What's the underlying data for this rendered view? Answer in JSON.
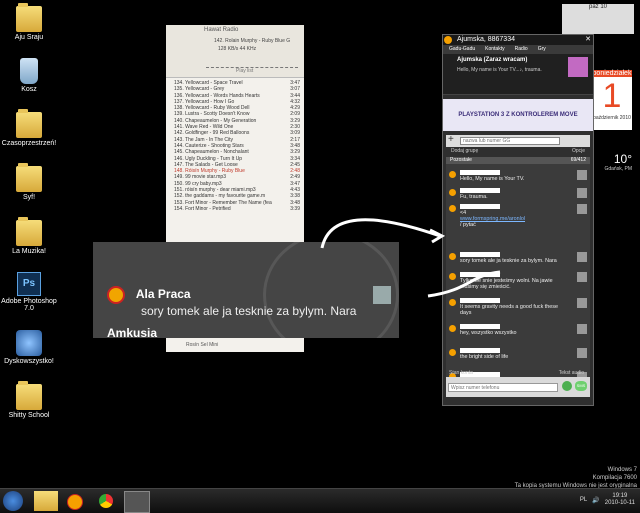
{
  "desktop": {
    "icons": [
      {
        "label": "Aju Sraju",
        "icon": "folder-icon"
      },
      {
        "label": "Kosz",
        "icon": "recycle-bin-icon"
      },
      {
        "label": "Czasoprzestrzeń!",
        "icon": "folder-icon"
      },
      {
        "label": "Syf!",
        "icon": "folder-icon"
      },
      {
        "label": "La Muzika!",
        "icon": "folder-icon"
      },
      {
        "label": "Adobe Photoshop 7.0",
        "icon": "photoshop-icon"
      },
      {
        "label": "Dyskowszystko!",
        "icon": "network-drive-icon"
      },
      {
        "label": "Shitty School",
        "icon": "folder-icon"
      }
    ]
  },
  "playlist": {
    "header_title": "Hawat Radio",
    "now_playing": "142. Rolain Murphy - Ruby Blue G",
    "bitrate": "128 KB/s 44 KHz",
    "label": "Play list",
    "tracks": [
      {
        "title": "134. Yellowcard - Space Travel",
        "time": "3:47"
      },
      {
        "title": "135. Yellowcard - Grey",
        "time": "3:07"
      },
      {
        "title": "136. Yellowcard - Words Hands Hearts",
        "time": "3:44"
      },
      {
        "title": "137. Yellowcard - How I Go",
        "time": "4:32"
      },
      {
        "title": "138. Yellowcard - Ruby Wood Dell",
        "time": "4:29"
      },
      {
        "title": "139. Lustra - Scotty Doesn't Know",
        "time": "2:09"
      },
      {
        "title": "140. Chapeaumelon - My Generation",
        "time": "3:29"
      },
      {
        "title": "141. Wave Red - Wild One",
        "time": "2:30"
      },
      {
        "title": "142. Goldfinger - 99 Red Balloons",
        "time": "3:09"
      },
      {
        "title": "143. The Jam - In The City",
        "time": "2:17"
      },
      {
        "title": "144. Cauterize - Shooting Stars",
        "time": "3:48"
      },
      {
        "title": "145. Chapeaumelon - Nonchalant",
        "time": "3:29"
      },
      {
        "title": "146. Ugly Duckling - Turn It Up",
        "time": "3:34"
      },
      {
        "title": "147. The Salads - Get Loose",
        "time": "2:45"
      },
      {
        "title": "148. Róisín Murphy - Ruby Blue",
        "time": "2:48",
        "current": true
      },
      {
        "title": "149. 99 movie star.mp3",
        "time": "2:49"
      },
      {
        "title": "150. 99 cry baby.mp3",
        "time": "3:47"
      },
      {
        "title": "151. róisín murphy - dear miami.mp3",
        "time": "4:43"
      },
      {
        "title": "152. the gaddams - my favourite game.m",
        "time": "3:38"
      },
      {
        "title": "153. Fort Minor - Remember The Name (fea",
        "time": "3:48"
      },
      {
        "title": "154. Fort Minor - Petrified",
        "time": "3:39"
      }
    ],
    "footer": "Rosín Sel Mini"
  },
  "zoom": {
    "contact1": "Ala Praca",
    "message1": "sory tomek ale ja tesknie za bylym. Nara",
    "contact2": "Amkusia"
  },
  "calendar": {
    "month": "paź 10"
  },
  "date_gadget": {
    "day_name": "poniedziałek",
    "day": "1",
    "month_year": "październik 2010"
  },
  "weather": {
    "temp": "10°",
    "city": "Gdańsk, PM"
  },
  "gg": {
    "title": "Ajumska, 8867334",
    "menu": [
      "Gadu-Gadu",
      "Kontakty",
      "Radio",
      "Gry"
    ],
    "me_name": "Ajumska (Zaraz wracam)",
    "me_desc": "Hello, My name is Your TV...♪, trauma.",
    "ad": "PLAYSTATION 3 Z KONTROLEREM MOVE",
    "search_placeholder": "nazwa lub numer GG",
    "add_group": "Dodaj grupę",
    "options": "Opcje",
    "group_name": "Pozostałe",
    "group_count": "69/412",
    "contacts": [
      {
        "line1": "Hello, My name is Your TV.",
        "line2": ""
      },
      {
        "line1": "Fu, trauma.",
        "line2": ""
      },
      {
        "line1": "<4",
        "link": "www.formspring.me/aronlol",
        "line2": "/ pytać"
      },
      {
        "line1": "sory tomek ale ja tesknie za bylym. Nara",
        "line2": ""
      },
      {
        "line1": "Tylko we snie jesteśmy wolni. Na jawie",
        "line2": "musimy się zmieścić."
      },
      {
        "line1": "It seems gravity needs a good fuck these",
        "line2": "days"
      },
      {
        "line1": "hey, wszystko wszystko",
        "line2": ""
      },
      {
        "line1": "the bright side of life",
        "line2": ""
      },
      {
        "line1": "Wykonam profesjonalne strony",
        "line2": "internetowe na zamówienie."
      }
    ],
    "status_label": "Stan konta",
    "text_audio": "Tekst audio",
    "phone_placeholder": "Wpisz numer telefonu",
    "sms_label": "SMS"
  },
  "watermark": {
    "line1": "Windows 7",
    "line2": "Kompilacja 7600",
    "line3": "Ta kopia systemu Windows nie jest oryginalna"
  },
  "tray": {
    "lang": "PL",
    "time": "19:19",
    "date": "2010-10-11"
  }
}
